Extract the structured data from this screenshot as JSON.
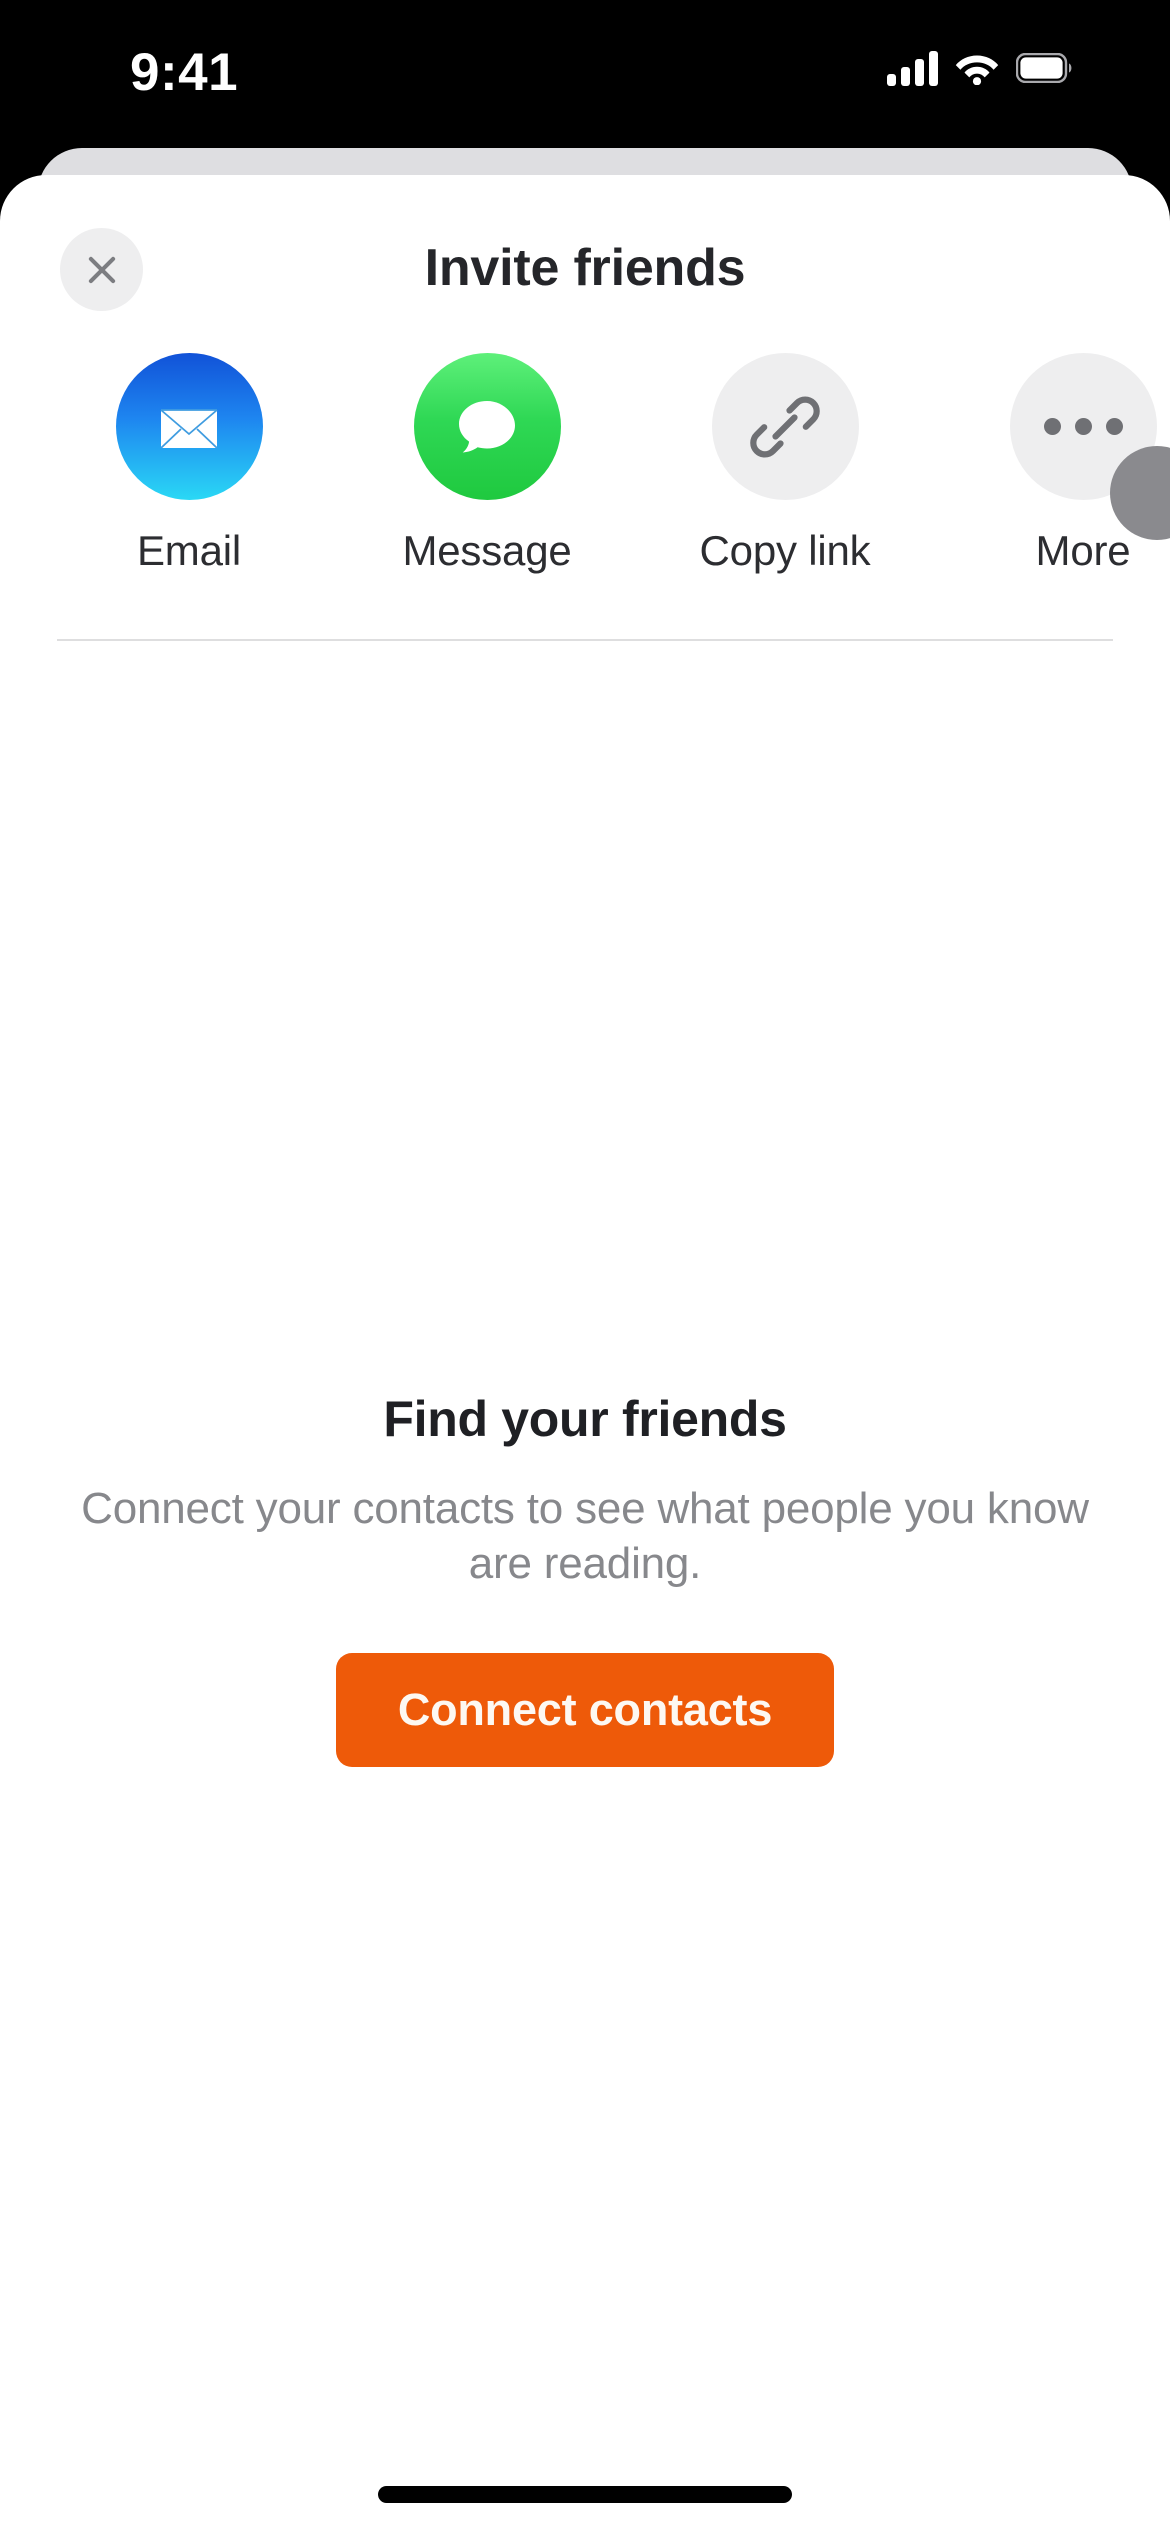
{
  "status_bar": {
    "time": "9:41",
    "signal_icon": "cellular-signal-icon",
    "wifi_icon": "wifi-icon",
    "battery_icon": "battery-icon"
  },
  "modal": {
    "title": "Invite friends",
    "close_icon": "close-icon",
    "share_targets": [
      {
        "label": "Email",
        "icon": "email-envelope-icon",
        "style": "email"
      },
      {
        "label": "Message",
        "icon": "message-bubble-icon",
        "style": "message"
      },
      {
        "label": "Copy link",
        "icon": "link-chain-icon",
        "style": "gray"
      },
      {
        "label": "More",
        "icon": "more-ellipsis-icon",
        "style": "gray"
      }
    ],
    "empty_state": {
      "title": "Find your friends",
      "subtitle": "Connect your contacts to see what people you know are reading.",
      "cta_label": "Connect contacts"
    }
  },
  "colors": {
    "accent_orange": "#ee5a09",
    "email_blue_top": "#1152d8",
    "email_cyan_bottom": "#2ad8f5",
    "message_green": "#2fd855",
    "gray_circle": "#eeeeef",
    "title_text": "#25262a",
    "subtitle_text": "#87888c",
    "divider": "#dededf"
  }
}
